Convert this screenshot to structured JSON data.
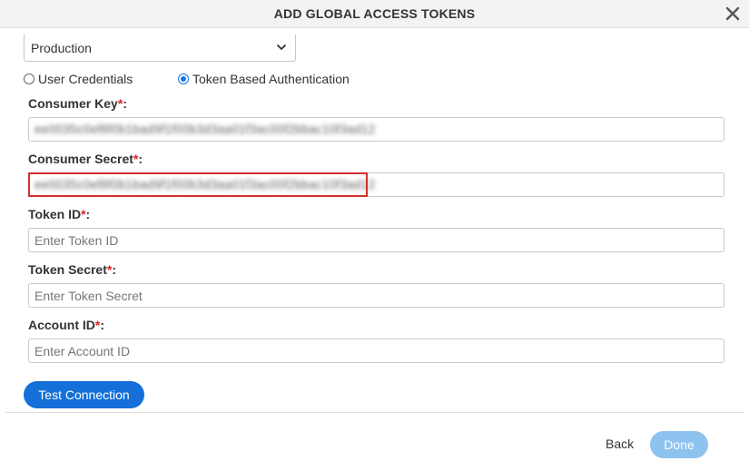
{
  "header": {
    "title": "ADD GLOBAL ACCESS TOKENS"
  },
  "environment": {
    "value": "Production"
  },
  "auth": {
    "options": [
      {
        "label": "User Credentials",
        "selected": false
      },
      {
        "label": "Token Based Authentication",
        "selected": true
      }
    ]
  },
  "fields": {
    "consumer_key": {
      "label": "Consumer Key",
      "required_mark": "*",
      "colon": ":",
      "value": "ee0035c0ef8f0b1bad9f1f00b3d3aa01f3ac00f2bbac10f3ad12",
      "placeholder": ""
    },
    "consumer_secret": {
      "label": "Consumer Secret",
      "required_mark": "*",
      "colon": ":",
      "value": "ee0035c0ef8f0b1bad9f1f00b3d3aa01f3ac00f2bbac10f3ad12",
      "placeholder": ""
    },
    "token_id": {
      "label": "Token ID",
      "required_mark": "*",
      "colon": ":",
      "value": "",
      "placeholder": "Enter Token ID"
    },
    "token_secret": {
      "label": "Token Secret",
      "required_mark": "*",
      "colon": ":",
      "value": "",
      "placeholder": "Enter Token Secret"
    },
    "account_id": {
      "label": "Account ID",
      "required_mark": "*",
      "colon": ":",
      "value": "",
      "placeholder": "Enter Account ID"
    }
  },
  "buttons": {
    "test_connection": "Test Connection",
    "back": "Back",
    "done": "Done"
  },
  "colors": {
    "primary": "#1470d8",
    "primary_disabled": "#8ec2ef",
    "required": "#e02020",
    "highlight": "#d32f2f"
  },
  "icons": {
    "close": "close-icon",
    "dropdown": "chevron-down-icon"
  }
}
